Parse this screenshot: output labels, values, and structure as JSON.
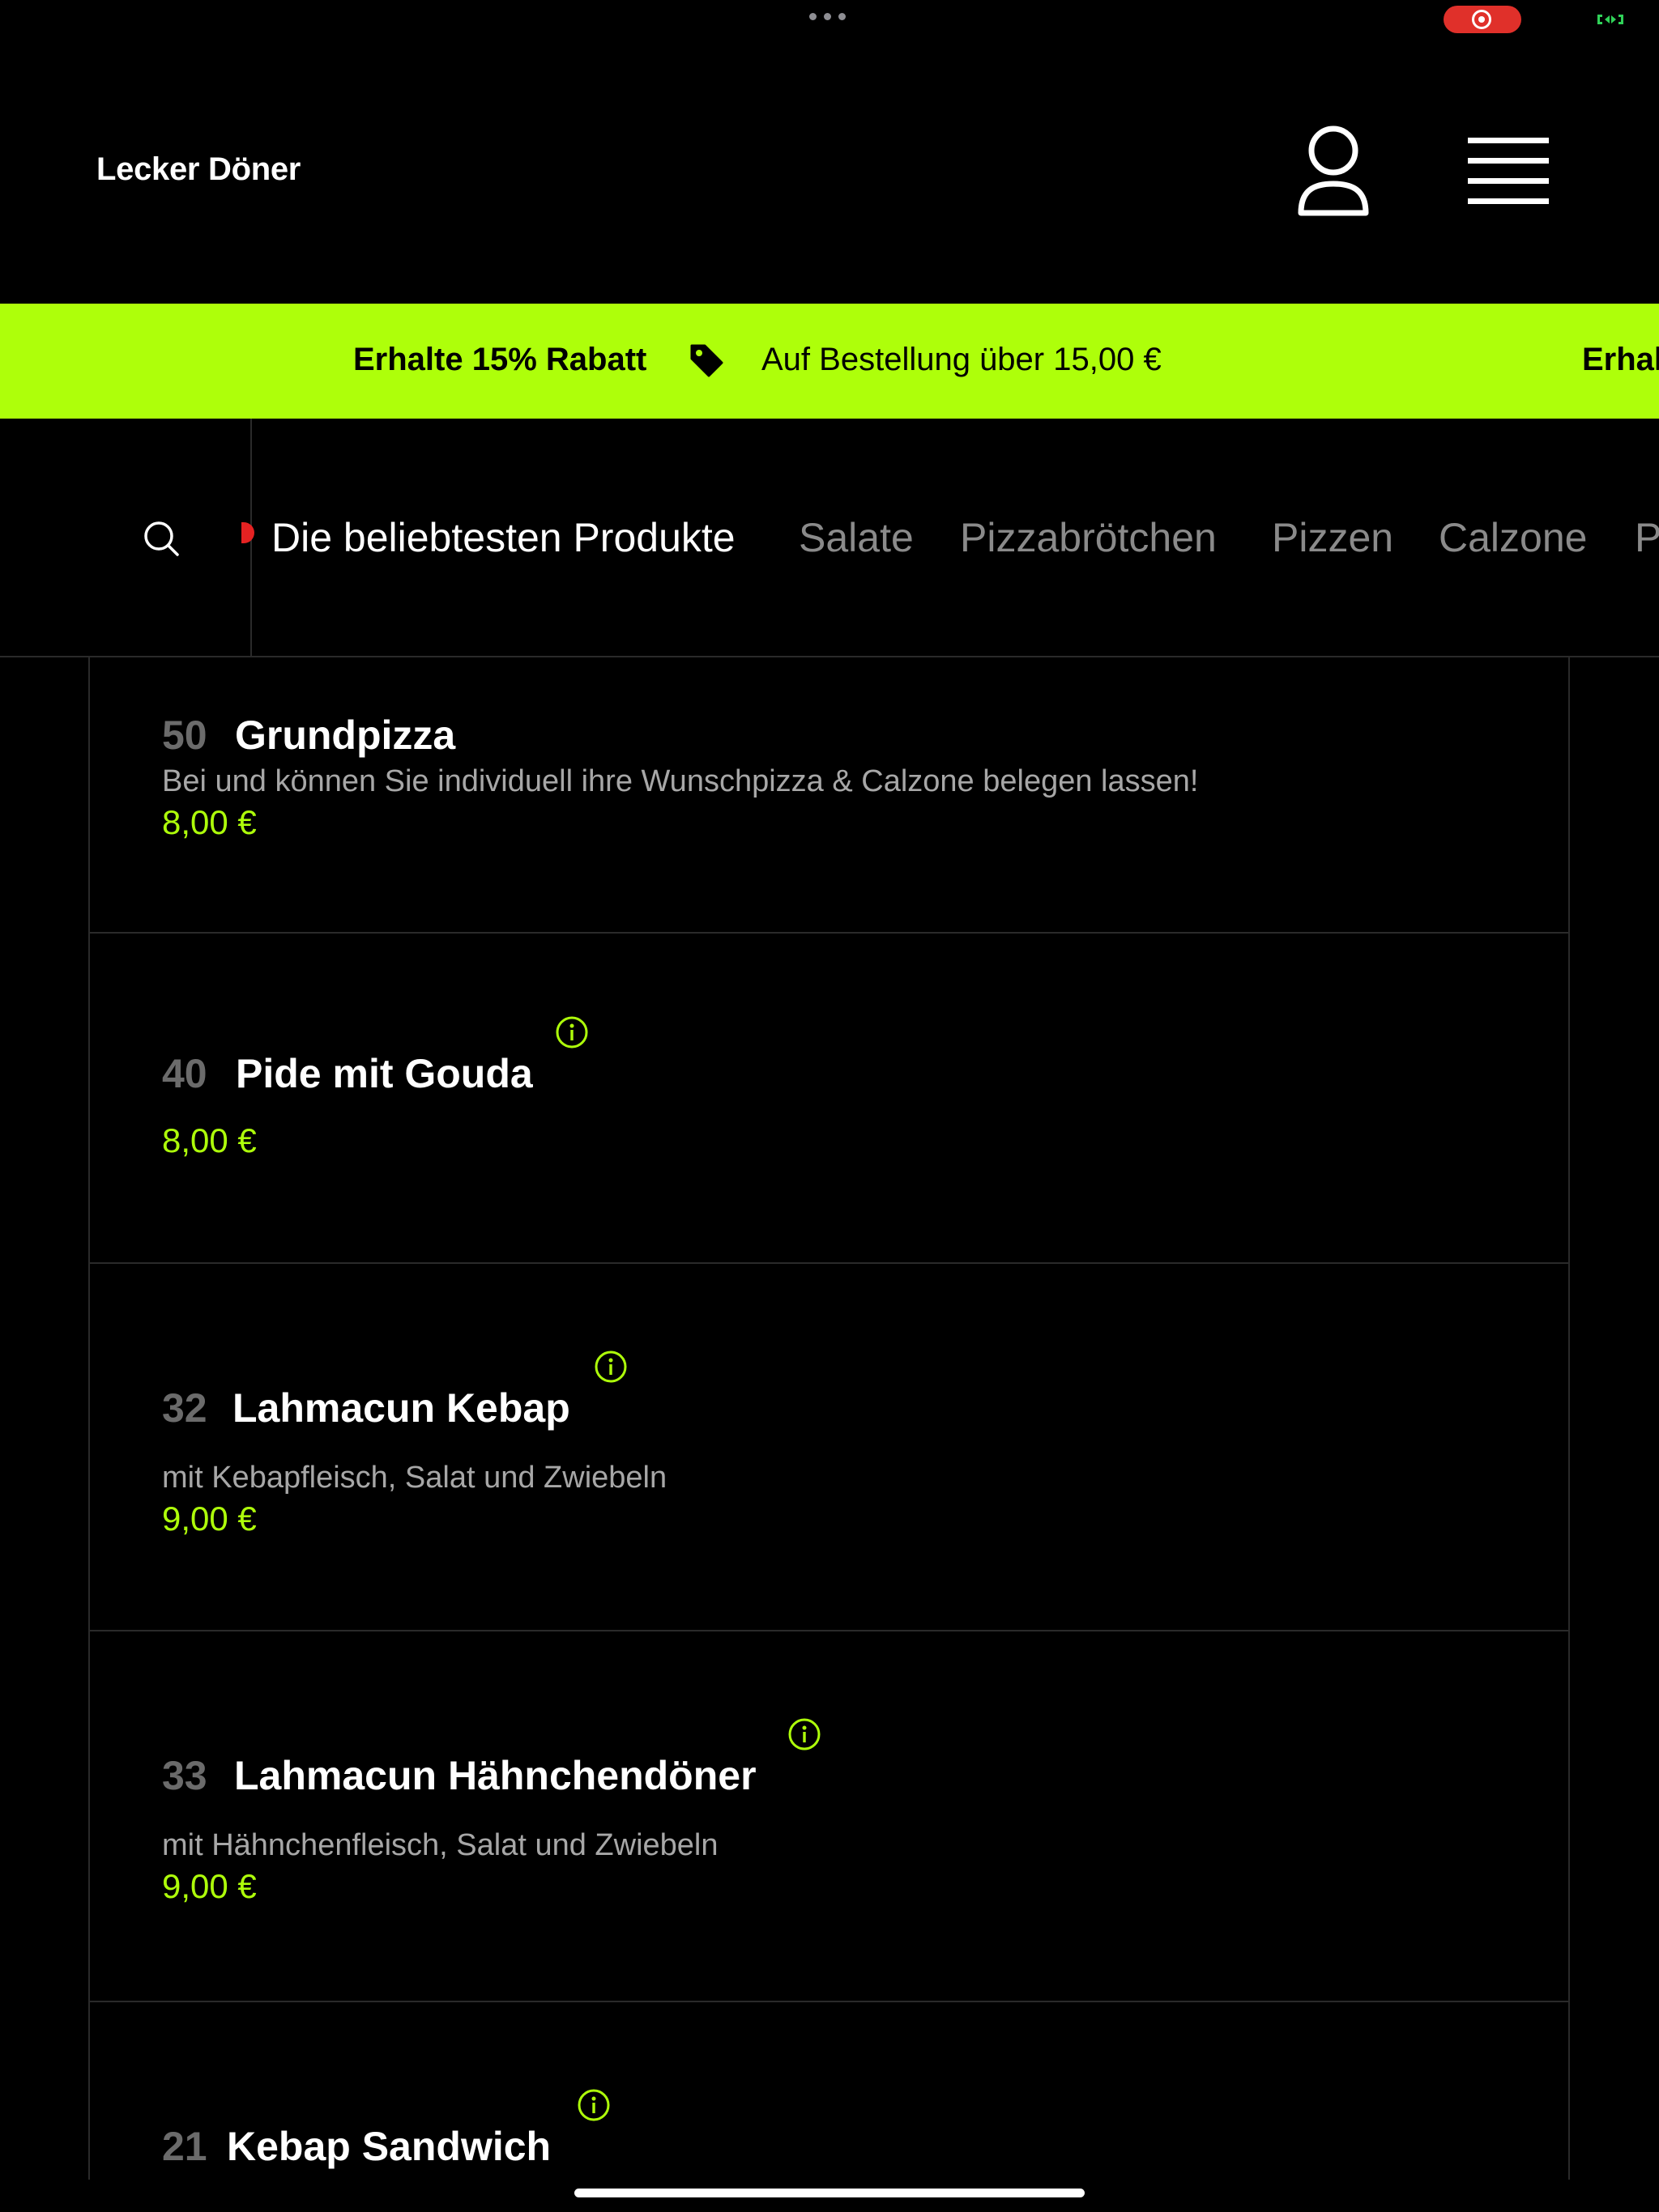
{
  "header": {
    "brand": "Lecker Döner",
    "user_icon": "user-icon",
    "menu_icon": "hamburger-menu-icon"
  },
  "promo": {
    "discount_label": "Erhalte 15% Rabatt",
    "condition_label": "Auf Bestellung über 15,00 €",
    "repeat_label": "Erhal",
    "icon": "tag-icon",
    "background_color": "#aeff0a"
  },
  "category_nav": {
    "search_icon": "search-icon",
    "tabs": [
      {
        "label": "Die beliebtesten Produkte",
        "active": true
      },
      {
        "label": "Salate",
        "active": false
      },
      {
        "label": "Pizzabrötchen",
        "active": false
      },
      {
        "label": "Pizzen",
        "active": false
      },
      {
        "label": "Calzone",
        "active": false
      },
      {
        "label": "P",
        "active": false
      }
    ]
  },
  "products": [
    {
      "number": "50",
      "name": "Grundpizza",
      "description": "Bei und können Sie individuell ihre Wunschpizza & Calzone belegen lassen!",
      "price": "8,00 €",
      "has_info": false
    },
    {
      "number": "40",
      "name": "Pide mit Gouda",
      "description": "",
      "price": "8,00 €",
      "has_info": true
    },
    {
      "number": "32",
      "name": "Lahmacun Kebap",
      "description": "mit Kebapfleisch, Salat und Zwiebeln",
      "price": "9,00 €",
      "has_info": true
    },
    {
      "number": "33",
      "name": "Lahmacun Hähnchendöner",
      "description": "mit Hähnchenfleisch, Salat und Zwiebeln",
      "price": "9,00 €",
      "has_info": true
    },
    {
      "number": "21",
      "name": "Kebap Sandwich",
      "description": "",
      "price": "",
      "has_info": true
    }
  ],
  "colors": {
    "accent": "#aeff0a",
    "background": "#000000",
    "muted_text": "#a7a7a7",
    "recording": "#e0302a"
  }
}
